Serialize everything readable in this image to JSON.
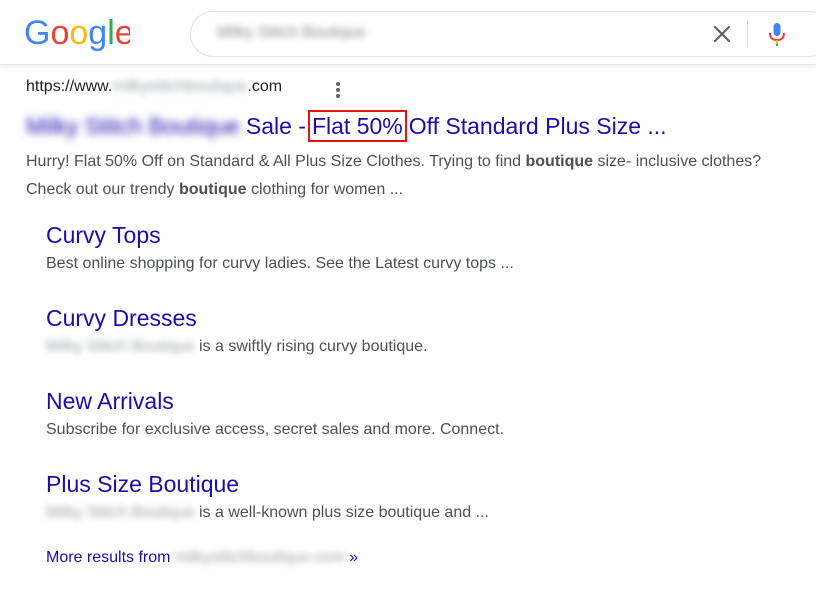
{
  "header": {
    "logo_text": "Google",
    "logo_letter_colors": [
      "#4285F4",
      "#EA4335",
      "#FBBC05",
      "#4285F4",
      "#34A853",
      "#EA4335"
    ],
    "search_query": "Milky Stitch Boutique",
    "clear_icon": "close-icon",
    "mic_icon": "microphone-icon"
  },
  "result": {
    "url_prefix": "https://www.",
    "url_domain": "milkystitchboutique",
    "url_suffix": ".com",
    "title_site": "Milky Stitch Boutique",
    "title_part1": "Sale -",
    "title_highlight": "Flat 50%",
    "title_part2": "Off Standard Plus Size ...",
    "snippet_1": "Hurry! Flat 50% Off on Standard & All Plus Size Clothes. Trying to find",
    "snippet_bold_1": "boutique",
    "snippet_2": "size- inclusive clothes? Check out our trendy",
    "snippet_bold_2": "boutique",
    "snippet_3": "clothing for women ..."
  },
  "sitelinks": [
    {
      "title": "Curvy Tops",
      "blurred": "",
      "desc": "Best online shopping for curvy ladies. See the Latest curvy tops ..."
    },
    {
      "title": "Curvy Dresses",
      "blurred": "Milky Stitch Boutique",
      "desc": "is a swiftly rising curvy boutique."
    },
    {
      "title": "New Arrivals",
      "blurred": "",
      "desc": "Subscribe for exclusive access, secret sales and more. Connect."
    },
    {
      "title": "Plus Size Boutique",
      "blurred": "Milky Stitch Boutique",
      "desc": "is a well-known plus size boutique and ..."
    }
  ],
  "more": {
    "label": "More results from",
    "domain": "milkystitchboutique.com",
    "arrow": "»"
  },
  "colors": {
    "link": "#1a0dab",
    "snippet": "#4d5156",
    "highlight_border": "#e21414"
  }
}
